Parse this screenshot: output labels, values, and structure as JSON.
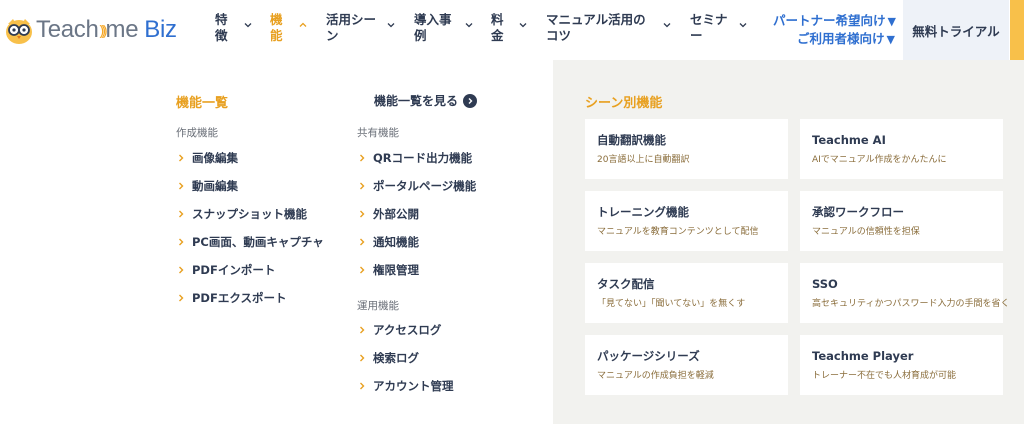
{
  "header": {
    "logo": {
      "text_main": "Teach",
      "text_after_waves": "me",
      "text_biz": "Biz"
    },
    "nav": [
      {
        "label": "特徴",
        "active": false
      },
      {
        "label": "機能",
        "active": true
      },
      {
        "label": "活用シーン",
        "active": false
      },
      {
        "label": "導入事例",
        "active": false
      },
      {
        "label": "料金",
        "active": false
      },
      {
        "label": "マニュアル活用のコツ",
        "active": false
      },
      {
        "label": "セミナー",
        "active": false
      }
    ],
    "partner_link": "パートナー希望向け",
    "user_link": "ご利用者様向け",
    "link_arrow": "▼",
    "trial_button": "無料トライアル"
  },
  "dropdown": {
    "features_title": "機能一覧",
    "see_all": "機能一覧を見る",
    "creation_group": "作成機能",
    "creation_items": [
      "画像編集",
      "動画編集",
      "スナップショット機能",
      "PC画面、動画キャプチャ",
      "PDFインポート",
      "PDFエクスポート"
    ],
    "sharing_group": "共有機能",
    "sharing_items": [
      "QRコード出力機能",
      "ポータルページ機能",
      "外部公開",
      "通知機能",
      "権限管理"
    ],
    "operation_group": "運用機能",
    "operation_items": [
      "アクセスログ",
      "検索ログ",
      "アカウント管理"
    ],
    "scene_title": "シーン別機能",
    "scene_cards": [
      {
        "title": "自動翻訳機能",
        "desc": "20言語以上に自動翻訳"
      },
      {
        "title": "Teachme AI",
        "desc": "AIでマニュアル作成をかんたんに"
      },
      {
        "title": "トレーニング機能",
        "desc": "マニュアルを教育コンテンツとして配信"
      },
      {
        "title": "承認ワークフロー",
        "desc": "マニュアルの信頼性を担保"
      },
      {
        "title": "タスク配信",
        "desc": "「見てない」「聞いてない」を無くす"
      },
      {
        "title": "SSO",
        "desc": "高セキュリティかつパスワード入力の手間を省く"
      },
      {
        "title": "パッケージシリーズ",
        "desc": "マニュアルの作成負担を軽減"
      },
      {
        "title": "Teachme Player",
        "desc": "トレーナー不在でも人材育成が可能"
      }
    ]
  },
  "colors": {
    "accent": "#e8a020",
    "link_blue": "#2f6fd0",
    "text": "#2f3b52",
    "panel_bg": "#f2f2ef",
    "trial_bg": "#eef2f8",
    "accent_bar": "#f8c04a"
  },
  "icons": {
    "logo": "owl-logo-icon",
    "nav_chevron": "chevron-down-icon",
    "nav_active_chevron": "chevron-up-icon",
    "link_arrow": "chevron-right-icon",
    "see_all": "arrow-circle-right-icon"
  }
}
